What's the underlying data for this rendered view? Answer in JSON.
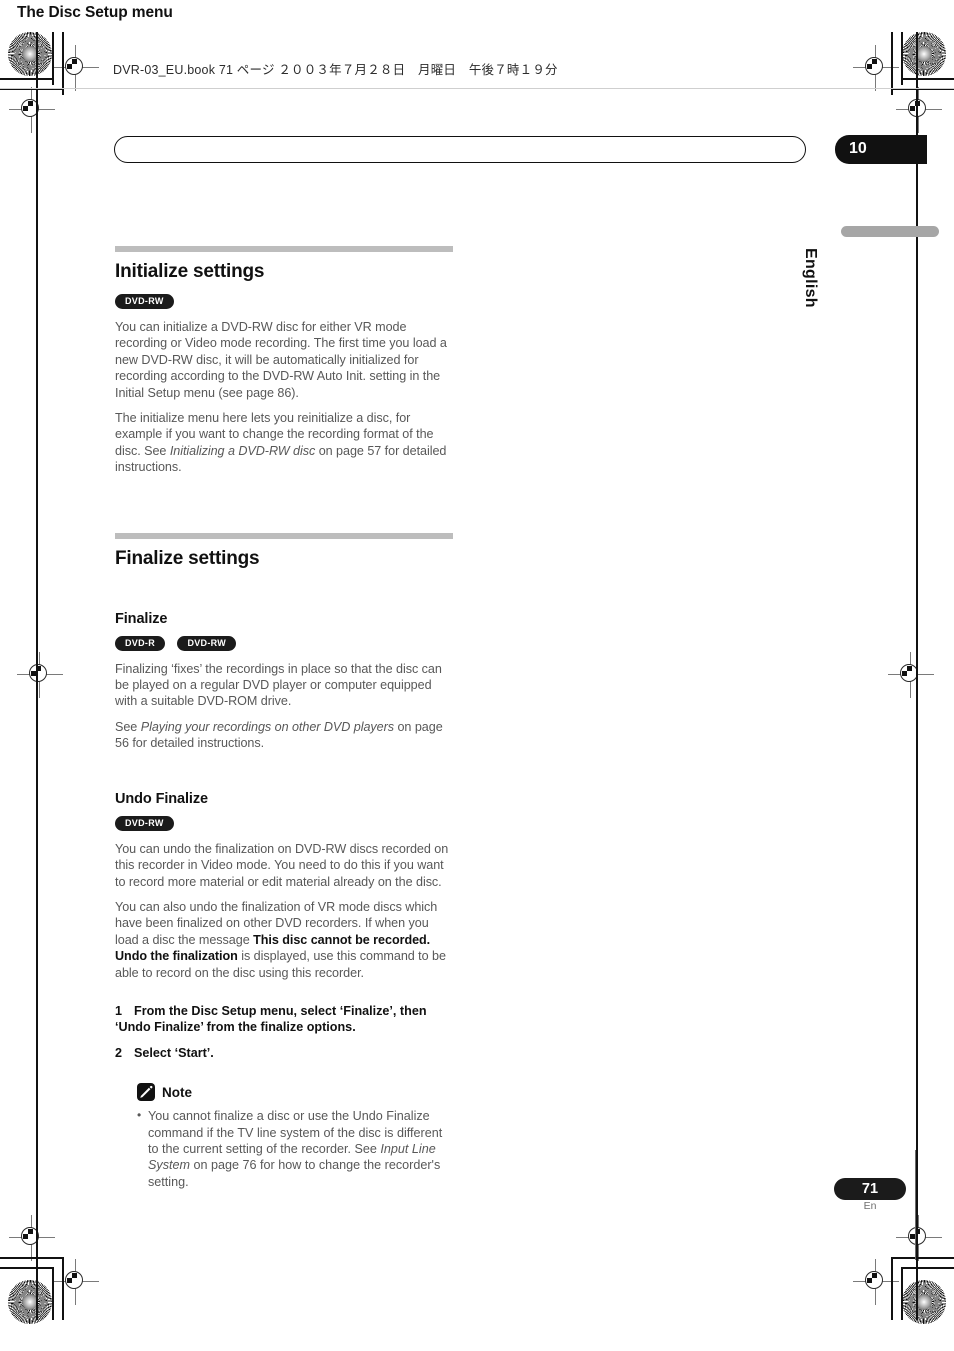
{
  "printmarks": {
    "filestamp": "DVR-03_EU.book  71 ページ  ２００３年７月２８日　月曜日　午後７時１９分"
  },
  "header": {
    "running_head": "The Disc Setup menu",
    "chapter_number": "10"
  },
  "rail": {
    "language": "English",
    "page_number": "71",
    "page_suffix": "En"
  },
  "sections": [
    {
      "title": "Initialize settings",
      "badges": [
        "DVD-RW"
      ],
      "paragraphs": [
        "You can initialize a DVD-RW disc for either VR mode recording or Video mode recording. The first time you load a new DVD-RW disc, it will be automatically initialized for recording according to the DVD-RW Auto Init. setting in the Initial Setup menu (see page 86).",
        "The initialize menu here lets you reinitialize a disc, for example if you want to change the recording format of the disc. See "
      ],
      "para2_italic": "Initializing a DVD-RW disc",
      "para2_tail": " on page 57 for detailed instructions."
    },
    {
      "title": "Finalize settings"
    }
  ],
  "finalize": {
    "subtitle": "Finalize",
    "badges": [
      "DVD-R",
      "DVD-RW"
    ],
    "para1": "Finalizing ‘fixes’ the recordings in place so that the disc can be played on a regular DVD player or computer equipped with a suitable DVD-ROM drive.",
    "para2_lead": "See ",
    "para2_italic": "Playing your recordings on other DVD players",
    "para2_tail": " on page 56 for detailed instructions."
  },
  "undo_finalize": {
    "subtitle": "Undo Finalize",
    "badges": [
      "DVD-RW"
    ],
    "para1": "You can undo the finalization on DVD-RW discs recorded on this recorder in Video mode. You need to do this if you want to record more material or edit material already on the disc.",
    "para2_lead": "You can also undo the finalization of VR mode discs which have been finalized on other DVD recorders. If when you load a disc the message ",
    "para2_bold": "This disc cannot be recorded. Undo the finalization",
    "para2_tail": " is displayed, use this command to be able to record on the disc using this recorder.",
    "steps": [
      {
        "num": "1",
        "text": "From the Disc Setup menu, select ‘Finalize’, then ‘Undo Finalize’ from the finalize options."
      },
      {
        "num": "2",
        "text": "Select ‘Start’."
      }
    ]
  },
  "note": {
    "title": "Note",
    "icon": "pencil-icon",
    "items": [
      {
        "lead": "You cannot finalize a disc or use the Undo Finalize command if the TV line system of the disc is different to the current setting of the recorder. See ",
        "italic": "Input Line System",
        "tail": " on page 76 for how to change the recorder's setting."
      }
    ]
  },
  "colors": {
    "rule": "#bdbdbd",
    "badge_bg": "#1b1b1b",
    "body_text": "#585858",
    "heading_text": "#111111",
    "lang_bar": "#a6a6a6"
  }
}
